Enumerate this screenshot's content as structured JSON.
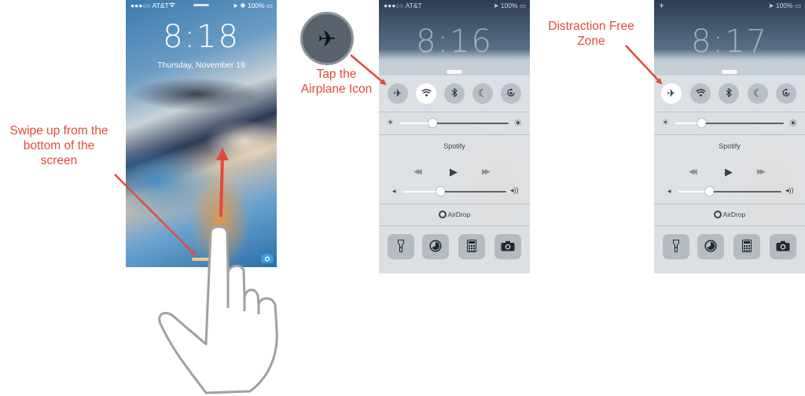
{
  "annotations": {
    "swipe": [
      "Swipe up from the",
      "bottom of the",
      "screen"
    ],
    "tap": [
      "Tap the",
      "Airplane Icon"
    ],
    "zone": [
      "Distraction Free",
      "Zone"
    ]
  },
  "accent_color": "#e24b3b",
  "lock_screen": {
    "carrier": "●●●○○ AT&T",
    "wifi_icon": "wifi-icon",
    "battery": "100%",
    "time": "8:18",
    "date": "Thursday, November 19",
    "camera_icon": "camera-icon"
  },
  "cc_before": {
    "carrier": "●●●○○ AT&T",
    "battery": "100%",
    "time": "8:16",
    "now_playing": "Spotify",
    "airdrop": "AirDrop",
    "airplane_on": false,
    "wifi_on": true,
    "brightness": 0.3,
    "volume": 0.36
  },
  "cc_after": {
    "carrier": "✈",
    "battery": "100%",
    "time": "8:17",
    "now_playing": "Spotify",
    "airdrop": "AirDrop",
    "airplane_on": true,
    "wifi_on": false,
    "brightness": 0.24,
    "volume": 0.3
  },
  "icons": {
    "airplane": "✈",
    "wifi": "wifi-icon",
    "bluetooth": "bluetooth-icon",
    "moon": "☾",
    "rotation_lock": "rotation-lock-icon",
    "rewind": "◀◀",
    "play": "▶",
    "fast_forward": "▶▶",
    "flashlight": "flashlight-icon",
    "timer": "timer-icon",
    "calculator": "calculator-icon",
    "camera": "camera-icon"
  }
}
